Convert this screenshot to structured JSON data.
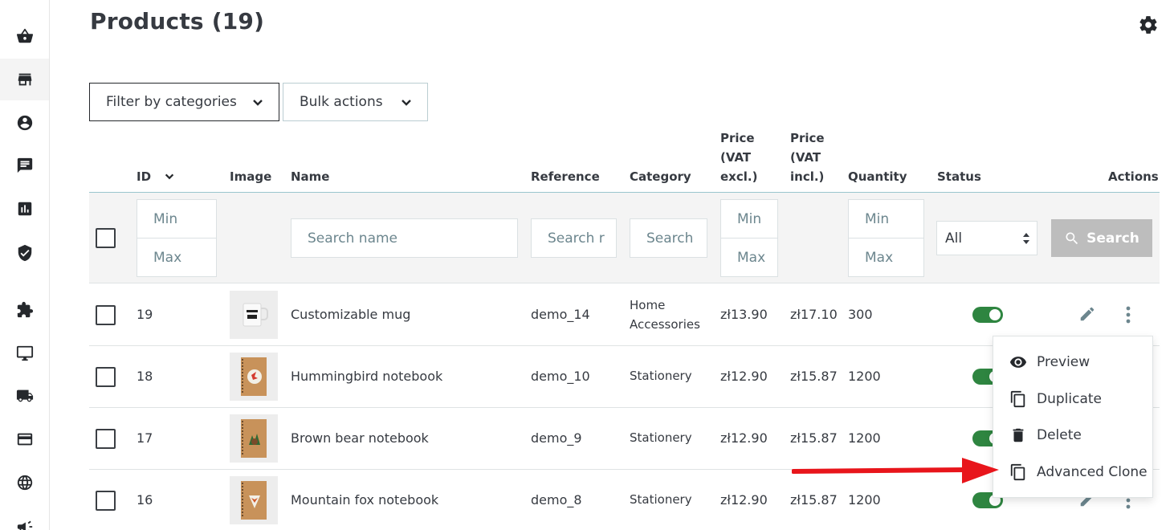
{
  "sidebar": {
    "items": [
      {
        "icon": "basket-icon"
      },
      {
        "icon": "store-icon"
      },
      {
        "icon": "account-circle-icon"
      },
      {
        "icon": "chat-icon"
      },
      {
        "icon": "bar-chart-icon"
      },
      {
        "icon": "shield-check-icon"
      },
      {
        "icon": "puzzle-icon"
      },
      {
        "icon": "monitor-icon"
      },
      {
        "icon": "truck-icon"
      },
      {
        "icon": "credit-card-icon"
      },
      {
        "icon": "globe-icon"
      },
      {
        "icon": "megaphone-icon"
      }
    ]
  },
  "header": {
    "title": "Products (19)"
  },
  "toolbar": {
    "filter_label": "Filter by categories",
    "bulk_label": "Bulk actions"
  },
  "table": {
    "columns": {
      "id": "ID",
      "image": "Image",
      "name": "Name",
      "reference": "Reference",
      "category": "Category",
      "price_excl": [
        "Price",
        "(VAT",
        "excl.)"
      ],
      "price_incl": [
        "Price",
        "(VAT",
        "incl.)"
      ],
      "quantity": "Quantity",
      "status": "Status",
      "actions": "Actions"
    },
    "filters": {
      "id_min": "Min",
      "id_max": "Max",
      "name": "Search name",
      "reference": "Search r",
      "category": "Search",
      "price_min": "Min",
      "price_max": "Max",
      "qty_min": "Min",
      "qty_max": "Max",
      "status": "All",
      "search_button": "Search"
    },
    "rows": [
      {
        "id": "19",
        "name": "Customizable mug",
        "reference": "demo_14",
        "category": [
          "Home",
          "Accessories"
        ],
        "price_excl": "zł13.90",
        "price_incl": "zł17.10",
        "quantity": "300",
        "status_enabled": true
      },
      {
        "id": "18",
        "name": "Hummingbird notebook",
        "reference": "demo_10",
        "category": [
          "Stationery"
        ],
        "price_excl": "zł12.90",
        "price_incl": "zł15.87",
        "quantity": "1200",
        "status_enabled": true
      },
      {
        "id": "17",
        "name": "Brown bear notebook",
        "reference": "demo_9",
        "category": [
          "Stationery"
        ],
        "price_excl": "zł12.90",
        "price_incl": "zł15.87",
        "quantity": "1200",
        "status_enabled": true
      },
      {
        "id": "16",
        "name": "Mountain fox notebook",
        "reference": "demo_8",
        "category": [
          "Stationery"
        ],
        "price_excl": "zł12.90",
        "price_incl": "zł15.87",
        "quantity": "1200",
        "status_enabled": true
      }
    ]
  },
  "actions_menu": {
    "items": [
      {
        "label": "Preview",
        "icon": "eye-icon"
      },
      {
        "label": "Duplicate",
        "icon": "copy-icon"
      },
      {
        "label": "Delete",
        "icon": "trash-icon"
      },
      {
        "label": "Advanced Clone",
        "icon": "copy-icon"
      }
    ]
  },
  "colors": {
    "toggle_on": "#2e8540",
    "annotation_arrow": "#e8151b",
    "search_button_disabled": "#bdbdbd"
  }
}
